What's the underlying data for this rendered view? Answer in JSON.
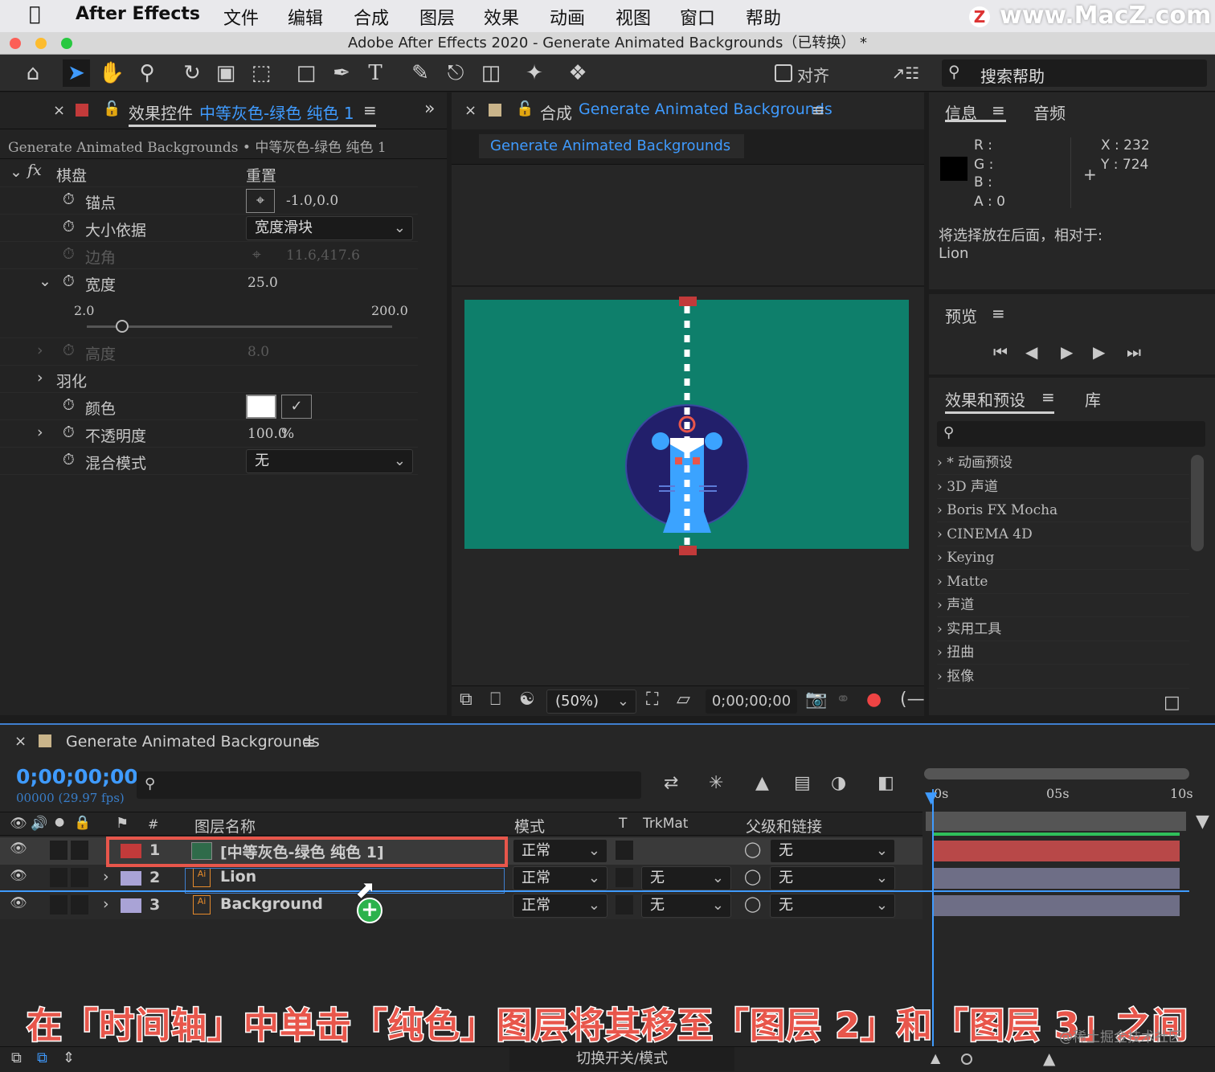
{
  "menubar": {
    "app": "After Effects",
    "items": [
      "文件",
      "编辑",
      "合成",
      "图层",
      "效果",
      "动画",
      "视图",
      "窗口",
      "帮助"
    ],
    "watermark": "www.MacZ.com"
  },
  "titlebar": {
    "title": "Adobe After Effects 2020 - Generate Animated Backgrounds（已转换） *"
  },
  "toolbar": {
    "align_label": "对齐",
    "search_help": "搜索帮助"
  },
  "effects_panel": {
    "tab": "效果控件",
    "layer": "中等灰色-绿色 纯色 1",
    "breadcrumb": "Generate Animated Backgrounds • 中等灰色-绿色 纯色 1",
    "effect_name": "棋盘",
    "reset": "重置",
    "props": {
      "anchor": "锚点",
      "anchor_val": "-1.0,0.0",
      "size_from": "大小依据",
      "size_from_val": "宽度滑块",
      "corner": "边角",
      "corner_val": "11.6,417.6",
      "width": "宽度",
      "width_val": "25.0",
      "slider_min": "2.0",
      "slider_max": "200.0",
      "height": "高度",
      "height_val": "8.0",
      "feather": "羽化",
      "color": "颜色",
      "opacity": "不透明度",
      "opacity_val": "100.0",
      "opacity_unit": "%",
      "blend": "混合模式",
      "blend_val": "无"
    }
  },
  "comp_panel": {
    "tab_prefix": "合成",
    "tab_name": "Generate Animated Backgrounds",
    "subtab": "Generate Animated Backgrounds",
    "zoom": "(50%)",
    "timecode": "0;00;00;00"
  },
  "info_panel": {
    "tab": "信息",
    "tab2": "音频",
    "r": "R :",
    "g": "G :",
    "b": "B :",
    "a": "A :  0",
    "x": "X : 232",
    "y": "Y :  724",
    "message": "将选择放在后面，相对于:",
    "target": "Lion"
  },
  "preview_panel": {
    "tab": "预览"
  },
  "ep_panel": {
    "tab": "效果和预设",
    "tab2": "库",
    "items": [
      "* 动画预设",
      "3D 声道",
      "Boris FX Mocha",
      "CINEMA 4D",
      "Keying",
      "Matte",
      "声道",
      "实用工具",
      "扭曲",
      "抠像"
    ]
  },
  "timeline": {
    "comp": "Generate Animated Backgrounds",
    "timecode": "0;00;00;00",
    "fps": "00000 (29.97 fps)",
    "headers": {
      "num": "#",
      "name": "图层名称",
      "mode": "模式",
      "t": "T",
      "trkmat": "TrkMat",
      "parent": "父级和链接"
    },
    "ruler": [
      "0s",
      "05s",
      "10s"
    ],
    "layers": [
      {
        "num": "1",
        "name": "[中等灰色-绿色 纯色 1]",
        "mode": "正常",
        "trkmat": "",
        "parent": "无",
        "color": "#c23a3a"
      },
      {
        "num": "2",
        "name": "Lion",
        "mode": "正常",
        "trkmat": "无",
        "parent": "无",
        "color": "#a9a3d6"
      },
      {
        "num": "3",
        "name": "Background",
        "mode": "正常",
        "trkmat": "无",
        "parent": "无",
        "color": "#a9a3d6"
      }
    ],
    "footer": "切换开关/模式"
  },
  "caption": "在「时间轴」中单击「纯色」图层将其移至「图层 2」和「图层 3」之间",
  "caption_watermark": "@稀土掘金技术社区",
  "colors": {
    "accent": "#3f9bff",
    "comp_bg": "#0e7f6b",
    "lion_circle": "#221f6b",
    "highlight": "#e8564b"
  }
}
